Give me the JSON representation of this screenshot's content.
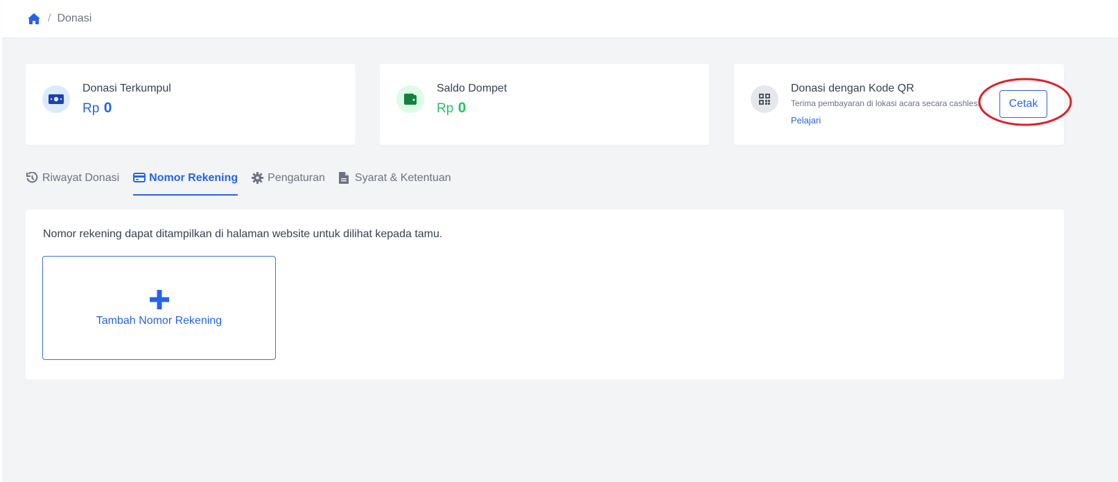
{
  "breadcrumb": {
    "separator": "/",
    "current": "Donasi"
  },
  "stats": {
    "donasi_terkumpul": {
      "title": "Donasi Terkumpul",
      "currency": "Rp",
      "value": "0"
    },
    "saldo_dompet": {
      "title": "Saldo Dompet",
      "currency": "Rp",
      "value": "0"
    },
    "qr": {
      "title": "Donasi dengan Kode QR",
      "description": "Terima pembayaran di lokasi acara secara cashless",
      "link": "Pelajari",
      "button": "Cetak"
    }
  },
  "tabs": [
    {
      "label": "Riwayat Donasi",
      "icon": "history-icon"
    },
    {
      "label": "Nomor Rekening",
      "icon": "credit-card-icon",
      "active": true
    },
    {
      "label": "Pengaturan",
      "icon": "gear-icon"
    },
    {
      "label": "Syarat & Ketentuan",
      "icon": "document-icon"
    }
  ],
  "panel": {
    "info": "Nomor rekening dapat ditampilkan di halaman website untuk dilihat kepada tamu.",
    "add_label": "Tambah Nomor Rekening"
  },
  "colors": {
    "primary": "#2563eb",
    "success": "#22c55e",
    "background": "#f3f4f6",
    "highlight": "#e11d2a"
  }
}
